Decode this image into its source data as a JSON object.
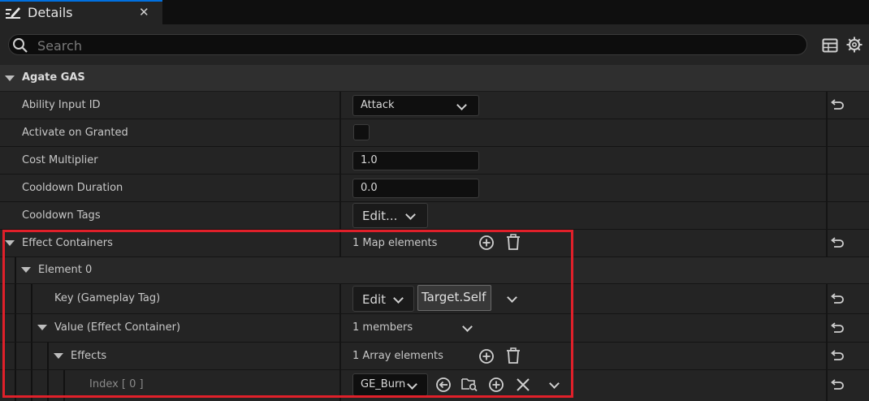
{
  "tab": {
    "title": "Details",
    "close": "✕"
  },
  "search": {
    "placeholder": "Search",
    "value": ""
  },
  "category": {
    "label": "Agate GAS"
  },
  "rows": {
    "ability_input_id": {
      "label": "Ability Input ID",
      "value": "Attack"
    },
    "activate_on_granted": {
      "label": "Activate on Granted",
      "checked": false
    },
    "cost_multiplier": {
      "label": "Cost Multiplier",
      "value": "1.0"
    },
    "cooldown_duration": {
      "label": "Cooldown Duration",
      "value": "0.0"
    },
    "cooldown_tags": {
      "label": "Cooldown Tags",
      "button": "Edit..."
    },
    "effect_containers": {
      "label": "Effect Containers",
      "summary": "1 Map elements"
    },
    "element0": {
      "label": "Element 0"
    },
    "key": {
      "label": "Key (Gameplay Tag)",
      "button": "Edit",
      "tag": "Target.Self"
    },
    "value": {
      "label": "Value (Effect Container)",
      "summary": "1 members"
    },
    "effects": {
      "label": "Effects",
      "summary": "1 Array elements"
    },
    "index0": {
      "label": "Index [ 0 ]",
      "value": "GE_Burn"
    }
  },
  "colors": {
    "accent": "#0070e0",
    "highlight": "#e0202a"
  }
}
